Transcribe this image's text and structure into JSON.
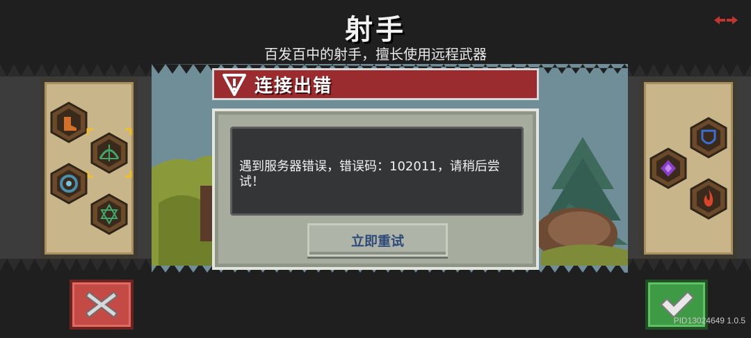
{
  "header": {
    "title": "射手",
    "subtitle": "百发百中的射手，擅长使用远程武器",
    "corner_icon": "swap-arrows-icon"
  },
  "left_skills": [
    {
      "icon": "boot-icon",
      "color": "#d0702a"
    },
    {
      "icon": "bow-icon",
      "color": "#3fa86a",
      "selected": true
    },
    {
      "icon": "vortex-icon",
      "color": "#4a8fb0"
    },
    {
      "icon": "hexagram-icon",
      "color": "#3fa86a"
    }
  ],
  "right_skills": [
    {
      "icon": "shield-icon",
      "color": "#3b6fd6"
    },
    {
      "icon": "purple-gem-icon",
      "color": "#8a3fc9"
    },
    {
      "icon": "fire-icon",
      "color": "#d9452a"
    }
  ],
  "dialog": {
    "title": "连接出错",
    "message": "遇到服务器错误，错误码：102011，请稍后尝试！",
    "retry_label": "立即重试"
  },
  "buttons": {
    "cancel_icon": "close-icon",
    "confirm_icon": "check-icon"
  },
  "footer": {
    "version": "PID13024649 1.0.5"
  },
  "colors": {
    "dialog_header": "#9a2b2e",
    "cancel": "#c44a46",
    "confirm": "#3f9a45"
  }
}
